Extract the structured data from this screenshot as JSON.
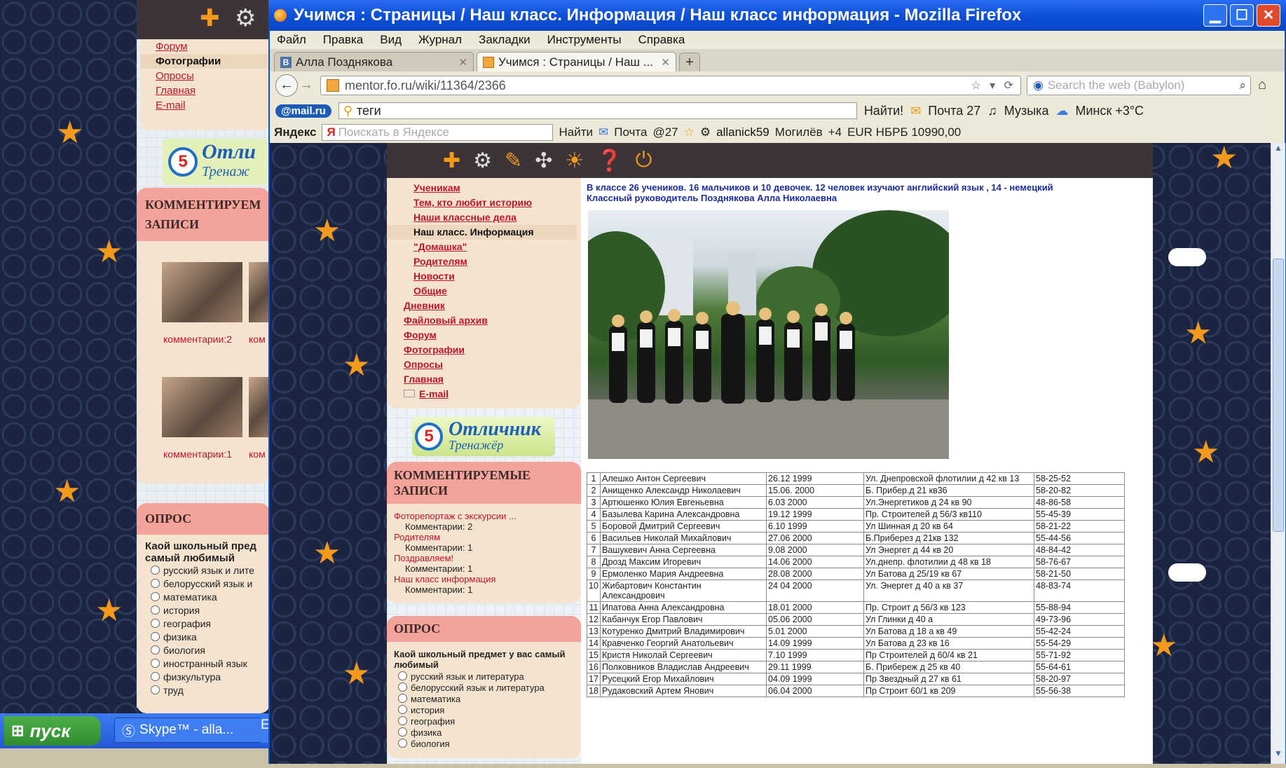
{
  "background_page": {
    "menu": [
      "Форум",
      "Фотографии",
      "Опросы",
      "Главная",
      "E-mail"
    ],
    "promo": {
      "num": "5",
      "title": "Отли",
      "subtitle": "Тренаж"
    },
    "commented_header": "КОММЕНТИРУЕМ ЗАПИСИ",
    "thumb_captions": [
      "комментарии:2",
      "ком",
      "комментарии:1",
      "ком"
    ],
    "poll_header": "ОПРОС",
    "poll_question": "Каой школьный пред самый любимый",
    "poll_options": [
      "русский язык и лите",
      "белорусский язык и",
      "математика",
      "история",
      "география",
      "физика",
      "биология",
      "иностранный язык",
      "физкультура",
      "труд"
    ]
  },
  "taskbar": {
    "start_label": "пуск",
    "items": [
      {
        "label": "Skype™ - alla..."
      },
      {
        "label": "E"
      }
    ]
  },
  "window": {
    "title": "Учимся : Страницы / Наш класс. Информация / Наш класс информация - Mozilla Firefox",
    "menus": [
      "Файл",
      "Правка",
      "Вид",
      "Журнал",
      "Закладки",
      "Инструменты",
      "Справка"
    ],
    "tabs": [
      {
        "label": "Алла Позднякова",
        "active": false
      },
      {
        "label": "Учимся : Страницы / Наш ...",
        "active": true
      }
    ],
    "url": "mentor.fo.ru/wiki/11364/2366",
    "search_placeholder": "Search the web (Babylon)",
    "mailbar": {
      "logo": "@mail.ru",
      "query": "теги",
      "find": "Найти!",
      "mail": "Почта 27",
      "music": "Музыка",
      "weather": "Минск +3°C"
    },
    "yandexbar": {
      "logo": "Яндекс",
      "placeholder": "Поискать в Яндексе",
      "find": "Найти",
      "mail": "Почта",
      "mail_count": "@27",
      "user": "allanick59",
      "city": "Могилёв",
      "temp": "+4",
      "rate": "EUR НБРБ 10990,00"
    }
  },
  "site": {
    "menu": [
      {
        "label": "Ученикам",
        "level": "sub",
        "current": false
      },
      {
        "label": "Тем, кто любит историю",
        "level": "sub",
        "current": false
      },
      {
        "label": "Наши классные дела",
        "level": "sub",
        "current": false
      },
      {
        "label": "Наш класс. Информация",
        "level": "sub",
        "current": true
      },
      {
        "label": "\"Домашка\"",
        "level": "sub",
        "current": false
      },
      {
        "label": "Родителям",
        "level": "sub",
        "current": false
      },
      {
        "label": "Новости",
        "level": "sub",
        "current": false
      },
      {
        "label": "Общие",
        "level": "sub",
        "current": false
      },
      {
        "label": "Дневник",
        "level": "top",
        "current": false
      },
      {
        "label": "Файловый архив",
        "level": "top",
        "current": false
      },
      {
        "label": "Форум",
        "level": "top",
        "current": false
      },
      {
        "label": "Фотографии",
        "level": "top",
        "current": false
      },
      {
        "label": "Опросы",
        "level": "top",
        "current": false
      },
      {
        "label": "Главная",
        "level": "top",
        "current": false
      },
      {
        "label": "E-mail",
        "level": "top",
        "current": false
      }
    ],
    "promo": {
      "num": "5",
      "title": "Отличник",
      "subtitle": "Тренажёр"
    },
    "commented": {
      "header": "КОММЕНТИРУЕМЫЕ ЗАПИСИ",
      "entries": [
        {
          "title": "Фоторепортаж с экскурсии ...",
          "comments": "Комментарии: 2"
        },
        {
          "title": "Родителям",
          "comments": "Комментарии: 1"
        },
        {
          "title": "Поздравляем!",
          "comments": "Комментарии: 1"
        },
        {
          "title": "Наш класс информация",
          "comments": "Комментарии: 1"
        }
      ]
    },
    "poll": {
      "header": "ОПРОС",
      "question": "Каой школьный предмет у вас самый любимый",
      "options": [
        "русский язык и литература",
        "белорусский язык и литература",
        "математика",
        "история",
        "география",
        "физика",
        "биология"
      ]
    },
    "intro_line1": "В классе 26 учеников.  16 мальчиков и 10 девочек. 12 человек изучают английский язык , 14 - немецкий",
    "intro_line2": "Классный руководитель Позднякова Алла Николаевна",
    "students": [
      {
        "n": "1",
        "name": "Алешко Антон Сергеевич",
        "dob": "26.12 1999",
        "addr": "Ул. Днепровской  флотилии д 42 кв 13",
        "phone": "58-25-52"
      },
      {
        "n": "2",
        "name": "Анищенко Александр Николаевич",
        "dob": "15.06. 2000",
        "addr": "Б. Прибер.д 21 кв36",
        "phone": "58-20-82"
      },
      {
        "n": "3",
        "name": "Артюшенко Юлия Евгеньевна",
        "dob": "6.03 2000",
        "addr": "Ул.Энергетиков д 24 кв 90",
        "phone": "48-86-58"
      },
      {
        "n": "4",
        "name": "Базылева Карина Александровна",
        "dob": "19.12 1999",
        "addr": "Пр. Строителей д 56/3 кв110",
        "phone": "55-45-39"
      },
      {
        "n": "5",
        "name": "Боровой Дмитрий Сергеевич",
        "dob": "6.10 1999",
        "addr": "Ул Шинная д 20 кв 64",
        "phone": "58-21-22"
      },
      {
        "n": "6",
        "name": "Васильев Николай Михайлович",
        "dob": "27.06 2000",
        "addr": "Б.Приберез д 21кв 132",
        "phone": "55-44-56"
      },
      {
        "n": "7",
        "name": "Вашукевич Анна Сергеевна",
        "dob": "9.08 2000",
        "addr": "Ул Энергет д 44 кв 20",
        "phone": "48-84-42"
      },
      {
        "n": "8",
        "name": "Дрозд Максим Игоревич",
        "dob": "14.06 2000",
        "addr": "Ул.днепр. флотилии д 48 кв 18",
        "phone": "58-76-67"
      },
      {
        "n": "9",
        "name": "Ермоленко Мария Андреевна",
        "dob": "28.08 2000",
        "addr": "Ул Батова д 25/19 кв 67",
        "phone": "58-21-50"
      },
      {
        "n": "10",
        "name": "Жибартович Константин Александрович",
        "dob": "24 04 2000",
        "addr": "Ул. Энергет д 40 а кв 37",
        "phone": "48-83-74"
      },
      {
        "n": "11",
        "name": "Ипатова Анна Александровна",
        "dob": "18.01 2000",
        "addr": "Пр. Строит д 56/3 кв 123",
        "phone": "55-88-94"
      },
      {
        "n": "12",
        "name": "Кабанчук Егор Павлович",
        "dob": "05.06 2000",
        "addr": "Ул Глинки д 40 а",
        "phone": "49-73-96"
      },
      {
        "n": "13",
        "name": "Котуренко Дмитрий Владимирович",
        "dob": "5.01 2000",
        "addr": "Ул Батова д 18 а кв 49",
        "phone": "55-42-24"
      },
      {
        "n": "14",
        "name": "Кравченко Георгий Анатольевич",
        "dob": "14.09 1999",
        "addr": "Ул Батова д 23 кв 16",
        "phone": "55-54-29"
      },
      {
        "n": "15",
        "name": "Кристя Николай Сергеевич",
        "dob": "7.10 1999",
        "addr": "Пр Строителей д 60/4 кв 21",
        "phone": "55-71-92"
      },
      {
        "n": "16",
        "name": "Полковников Владислав Андреевич",
        "dob": "29.11 1999",
        "addr": "Б. Прибереж д 25 кв 40",
        "phone": "55-64-61"
      },
      {
        "n": "17",
        "name": "Русецкий Егор Михайлович",
        "dob": "04.09 1999",
        "addr": "Пр Звездный д 27 кв 61",
        "phone": "58-20-97"
      },
      {
        "n": "18",
        "name": "Рудаковский Артем Янович",
        "dob": "06.04 2000",
        "addr": "Пр Строит 60/1 кв 209",
        "phone": "55-56-38"
      }
    ]
  }
}
